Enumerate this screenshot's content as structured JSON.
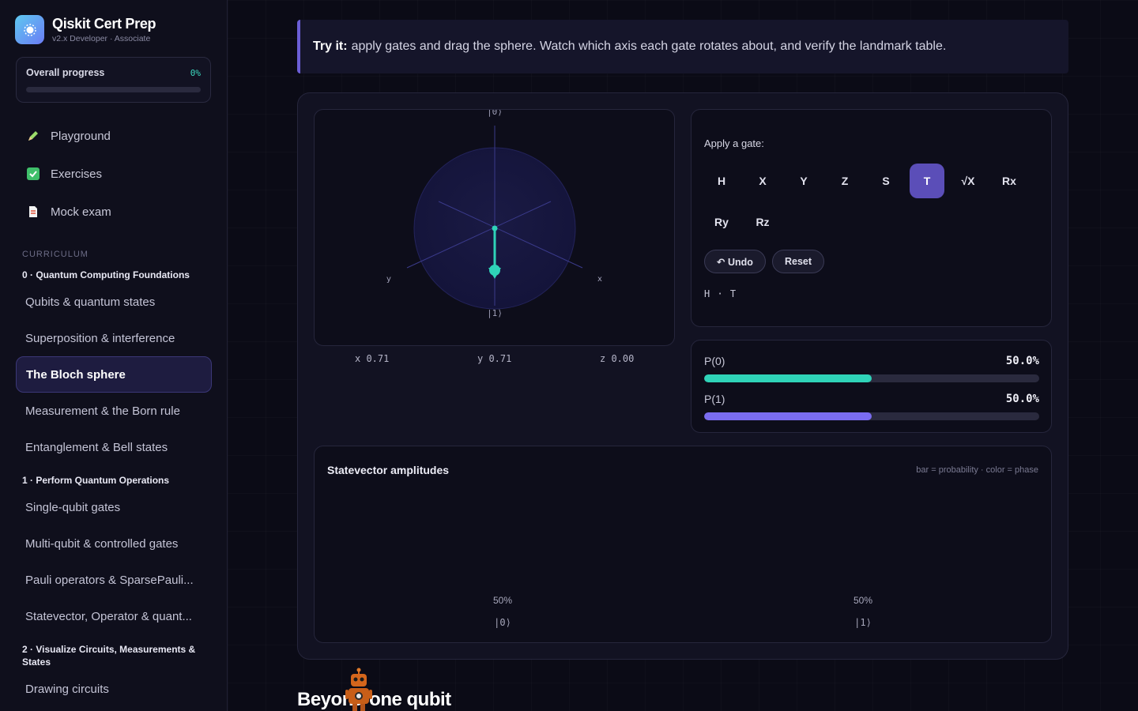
{
  "brand": {
    "title": "Qiskit Cert Prep",
    "subtitle": "v2.x Developer · Associate"
  },
  "progress": {
    "label": "Overall progress",
    "value": "0%",
    "fraction": 0
  },
  "nav": [
    {
      "label": "Playground",
      "icon": "pencil-icon"
    },
    {
      "label": "Exercises",
      "icon": "checkbox-icon"
    },
    {
      "label": "Mock exam",
      "icon": "document-icon"
    }
  ],
  "curriculum": {
    "heading": "CURRICULUM",
    "modules": [
      {
        "title": "0 · Quantum Computing Foundations",
        "lessons": [
          "Qubits & quantum states",
          "Superposition & interference",
          "The Bloch sphere",
          "Measurement & the Born rule",
          "Entanglement & Bell states"
        ]
      },
      {
        "title": "1 · Perform Quantum Operations",
        "lessons": [
          "Single-qubit gates",
          "Multi-qubit & controlled gates",
          "Pauli operators & SparsePauli...",
          "Statevector, Operator & quant..."
        ]
      },
      {
        "title": "2 · Visualize Circuits, Measurements & States",
        "lessons": [
          "Drawing circuits"
        ]
      }
    ],
    "active_lesson": "The Bloch sphere"
  },
  "tryit": {
    "bold": "Try it:",
    "text": "apply gates and drag the sphere. Watch which axis each gate rotates about, and verify the landmark table."
  },
  "bloch": {
    "top_label": "|0⟩",
    "bottom_label": "|1⟩",
    "x_axis": "x",
    "y_axis": "y",
    "coords": {
      "x": "x 0.71",
      "y": "y 0.71",
      "z": "z 0.00"
    }
  },
  "gates": {
    "label": "Apply a gate:",
    "buttons": [
      "H",
      "X",
      "Y",
      "Z",
      "S",
      "T",
      "√X",
      "Rx",
      "Ry",
      "Rz"
    ],
    "active": "T",
    "undo": "↶ Undo",
    "reset": "Reset",
    "history": "H · T"
  },
  "probabilities": [
    {
      "label": "P(0)",
      "value": "50.0%",
      "fraction": 0.5,
      "color": "#2fd3b8"
    },
    {
      "label": "P(1)",
      "value": "50.0%",
      "fraction": 0.5,
      "color": "#7a6cf0"
    }
  ],
  "statevector": {
    "title": "Statevector amplitudes",
    "legend": "bar = probability · color = phase",
    "amplitudes": [
      {
        "ket": "|0⟩",
        "pct": "50%"
      },
      {
        "ket": "|1⟩",
        "pct": "50%"
      }
    ]
  },
  "next_heading": "Beyond one qubit",
  "colors": {
    "accent": "#5b4eb8",
    "teal": "#2fd3b8",
    "violet": "#7a6cf0"
  }
}
